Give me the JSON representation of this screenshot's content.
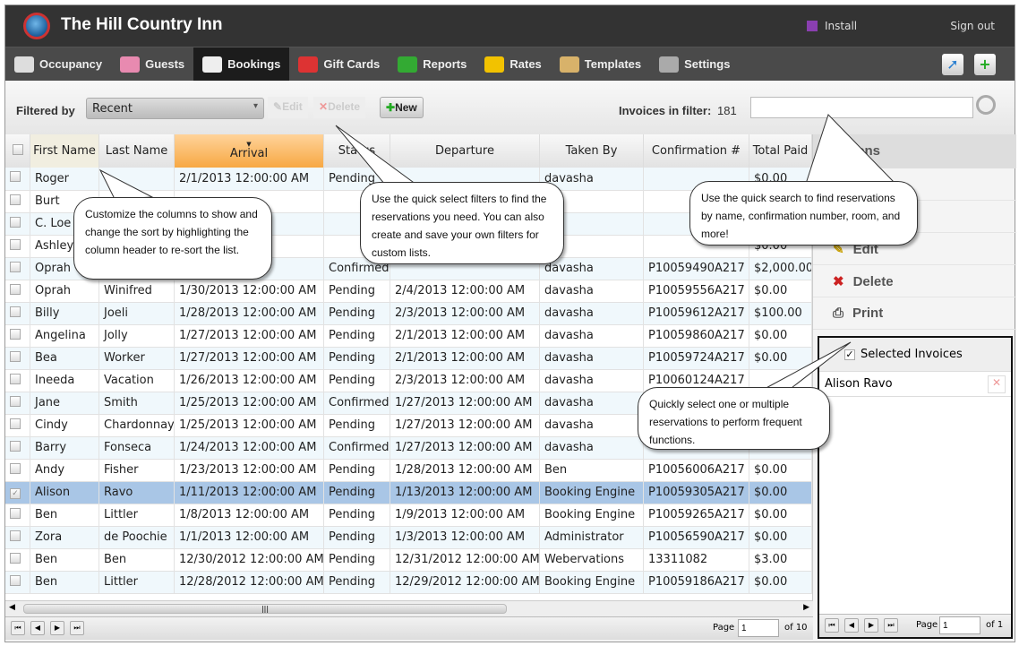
{
  "app": {
    "title": "The Hill Country Inn",
    "install": "Install",
    "sign_out": "Sign out"
  },
  "nav": [
    {
      "label": "Occupancy",
      "icon": "calendar-icon",
      "color": "#ddd"
    },
    {
      "label": "Guests",
      "icon": "users-icon",
      "color": "#e88ab0"
    },
    {
      "label": "Bookings",
      "icon": "book-icon",
      "color": "#eee",
      "active": true
    },
    {
      "label": "Gift Cards",
      "icon": "gift-icon",
      "color": "#d33"
    },
    {
      "label": "Reports",
      "icon": "bar-chart-icon",
      "color": "#3a3"
    },
    {
      "label": "Rates",
      "icon": "dollar-icon",
      "color": "#f2c200"
    },
    {
      "label": "Templates",
      "icon": "folder-icon",
      "color": "#d8b26a"
    },
    {
      "label": "Settings",
      "icon": "gear-icon",
      "color": "#aaa"
    }
  ],
  "toolbar": {
    "filtered_by": "Filtered by",
    "filter_value": "Recent",
    "edit": "Edit",
    "delete": "Delete",
    "new": "New",
    "invoices_label": "Invoices in filter:",
    "invoices_count": "181",
    "search_value": ""
  },
  "grid": {
    "columns": [
      "First Name",
      "Last Name",
      "Arrival",
      "Status",
      "Departure",
      "Taken By",
      "Confirmation #",
      "Total Paid"
    ],
    "sorted_column": "Arrival",
    "rows": [
      [
        "Roger",
        "",
        "2/1/2013 12:00:00 AM",
        "Pending",
        "",
        "davasha",
        "",
        "$0.00"
      ],
      [
        "Burt",
        "",
        "",
        "",
        "",
        "",
        "",
        ""
      ],
      [
        "C. Loe",
        "",
        "",
        "",
        "",
        "",
        "",
        ""
      ],
      [
        "Ashley",
        "",
        "",
        "",
        "",
        "",
        "",
        "$0.00"
      ],
      [
        "Oprah",
        "",
        "",
        "Confirmed",
        "",
        "davasha",
        "P10059490A217",
        "$2,000.00"
      ],
      [
        "Oprah",
        "Winifred",
        "1/30/2013 12:00:00 AM",
        "Pending",
        "2/4/2013 12:00:00 AM",
        "davasha",
        "P10059556A217",
        "$0.00"
      ],
      [
        "Billy",
        "Joeli",
        "1/28/2013 12:00:00 AM",
        "Pending",
        "2/3/2013 12:00:00 AM",
        "davasha",
        "P10059612A217",
        "$100.00"
      ],
      [
        "Angelina",
        "Jolly",
        "1/27/2013 12:00:00 AM",
        "Pending",
        "2/1/2013 12:00:00 AM",
        "davasha",
        "P10059860A217",
        "$0.00"
      ],
      [
        "Bea",
        "Worker",
        "1/27/2013 12:00:00 AM",
        "Pending",
        "2/1/2013 12:00:00 AM",
        "davasha",
        "P10059724A217",
        "$0.00"
      ],
      [
        "Ineeda",
        "Vacation",
        "1/26/2013 12:00:00 AM",
        "Pending",
        "2/3/2013 12:00:00 AM",
        "davasha",
        "P10060124A217",
        ""
      ],
      [
        "Jane",
        "Smith",
        "1/25/2013 12:00:00 AM",
        "Confirmed",
        "1/27/2013 12:00:00 AM",
        "davasha",
        "",
        ""
      ],
      [
        "Cindy",
        "Chardonnay",
        "1/25/2013 12:00:00 AM",
        "Pending",
        "1/27/2013 12:00:00 AM",
        "davasha",
        "",
        ""
      ],
      [
        "Barry",
        "Fonseca",
        "1/24/2013 12:00:00 AM",
        "Confirmed",
        "1/27/2013 12:00:00 AM",
        "davasha",
        "",
        ""
      ],
      [
        "Andy",
        "Fisher",
        "1/23/2013 12:00:00 AM",
        "Pending",
        "1/28/2013 12:00:00 AM",
        "Ben",
        "P10056006A217",
        "$0.00"
      ],
      [
        "Alison",
        "Ravo",
        "1/11/2013 12:00:00 AM",
        "Pending",
        "1/13/2013 12:00:00 AM",
        "Booking Engine",
        "P10059305A217",
        "$0.00"
      ],
      [
        "Ben",
        "Littler",
        "1/8/2013 12:00:00 AM",
        "Pending",
        "1/9/2013 12:00:00 AM",
        "Booking Engine",
        "P10059265A217",
        "$0.00"
      ],
      [
        "Zora",
        "de Poochie",
        "1/1/2013 12:00:00 AM",
        "Pending",
        "1/3/2013 12:00:00 AM",
        "Administrator",
        "P10056590A217",
        "$0.00"
      ],
      [
        "Ben",
        "Ben",
        "12/30/2012 12:00:00 AM",
        "Pending",
        "12/31/2012 12:00:00 AM",
        "Webervations",
        "13311082",
        "$3.00"
      ],
      [
        "Ben",
        "Littler",
        "12/28/2012 12:00:00 AM",
        "Pending",
        "12/29/2012 12:00:00 AM",
        "Booking Engine",
        "P10059186A217",
        "$0.00"
      ]
    ],
    "selected_row": 14,
    "pager": {
      "label": "Page",
      "page": "1",
      "of": "of 10"
    }
  },
  "actions": {
    "header": "Actions",
    "items": [
      {
        "label": "",
        "icon": "add-icon"
      },
      {
        "label": "",
        "icon": "copy-icon"
      },
      {
        "label": "Edit",
        "icon": "pencil-icon"
      },
      {
        "label": "Delete",
        "icon": "x-icon"
      },
      {
        "label": "Print",
        "icon": "printer-icon"
      }
    ]
  },
  "selected": {
    "header": "Selected Invoices",
    "items": [
      "Alison Ravo"
    ],
    "pager": {
      "label": "Page",
      "page": "1",
      "of": "of 1"
    }
  },
  "callouts": {
    "columns": "Customize the columns to show and change the sort by highlighting the column header to re-sort the list.",
    "filters": "Use the quick select filters to find the reservations you need. You can also create and save your own filters for custom lists.",
    "search": "Use the quick search to find reservations by name, confirmation number, room, and more!",
    "select": "Quickly select one or multiple reservations to perform frequent functions."
  }
}
